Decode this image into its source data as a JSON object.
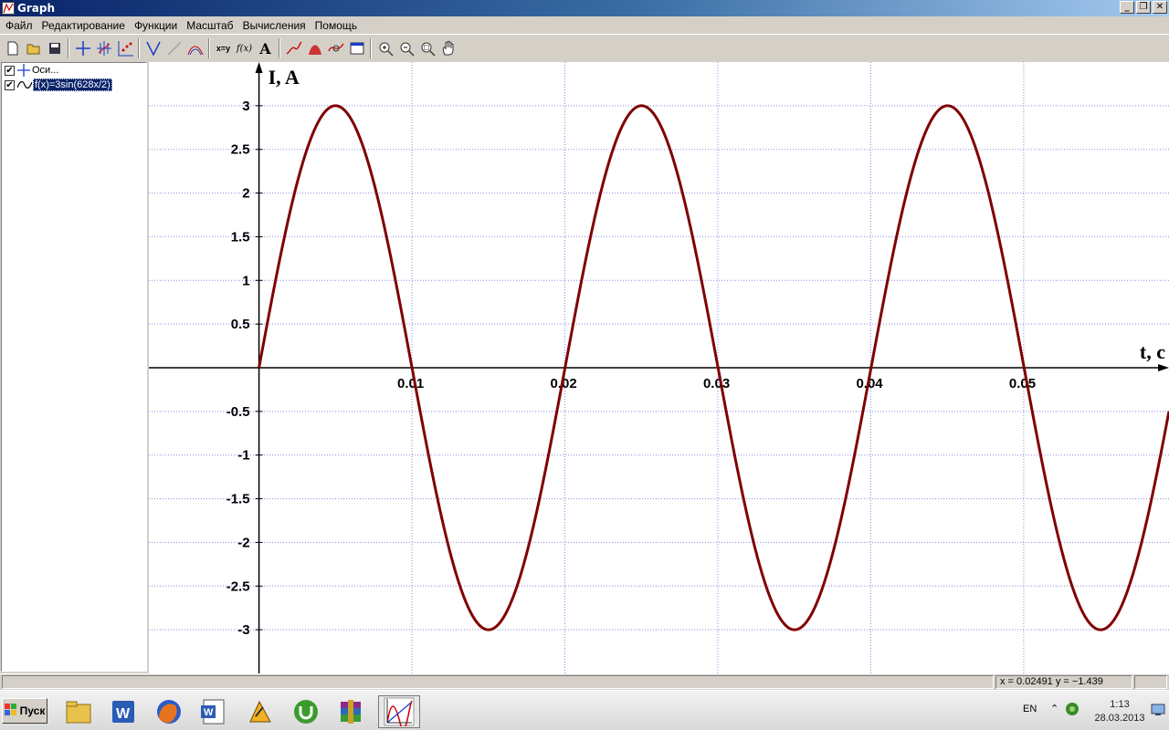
{
  "window": {
    "title": "Graph"
  },
  "menu": [
    "Файл",
    "Редактирование",
    "Функции",
    "Масштаб",
    "Вычисления",
    "Помощь"
  ],
  "sidebar": {
    "items": [
      {
        "label": "Оси...",
        "checked": true,
        "selected": false,
        "icon": "axes-icon"
      },
      {
        "label": "f(x)=3sin(628x/2)",
        "checked": true,
        "selected": true,
        "icon": "function-curve-icon"
      }
    ]
  },
  "status": {
    "coords": "x = 0.02491   y = −1.439"
  },
  "taskbar": {
    "start_label": "Пуск",
    "lang": "EN",
    "time": "1:13",
    "date": "28.03.2013"
  },
  "chart_data": {
    "type": "line",
    "function": "3sin(628x/2)",
    "amplitude": 3,
    "omega": 314,
    "xlabel": "t, c",
    "ylabel": "I, A",
    "xlim": [
      -0.0072,
      0.0595
    ],
    "ylim": [
      -3.5,
      3.5
    ],
    "x_ticks": [
      "0.01",
      "0.02",
      "0.03",
      "0.04",
      "0.05"
    ],
    "y_ticks": [
      "3",
      "2.5",
      "2",
      "1.5",
      "1",
      "0.5",
      "-0.5",
      "-1",
      "-1.5",
      "-2",
      "-2.5",
      "-3"
    ],
    "grid": true,
    "line_color": "#800000",
    "grid_color": "#8c8ce6"
  }
}
